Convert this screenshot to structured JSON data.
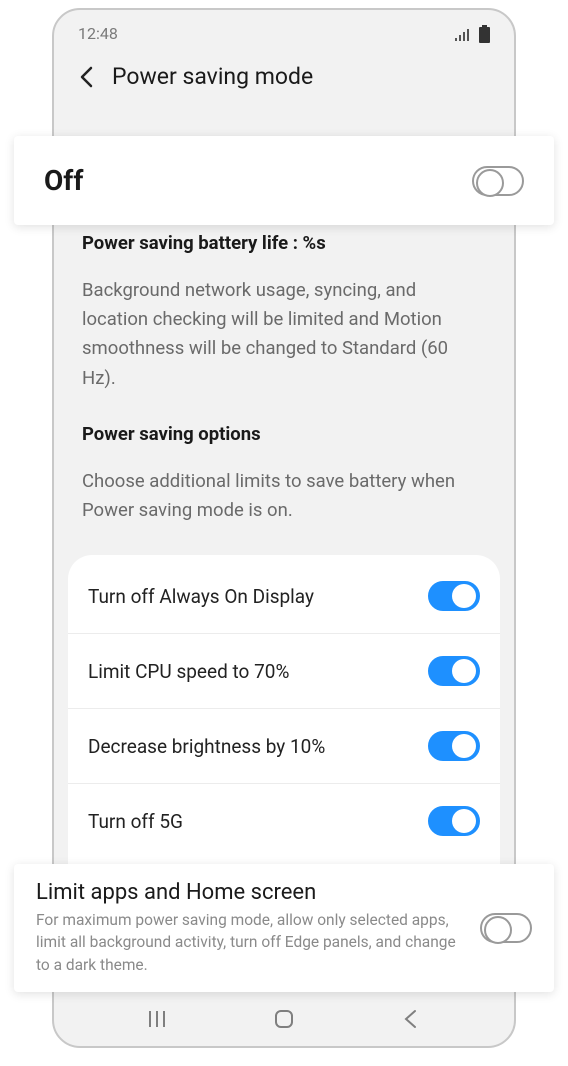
{
  "status": {
    "time": "12:48"
  },
  "header": {
    "title": "Power saving mode"
  },
  "main_toggle": {
    "label": "Off",
    "state": "off"
  },
  "battery_info": {
    "heading": "Power saving battery life : %s",
    "description": "Background network usage, syncing, and location checking will be limited and Motion smoothness will be changed to Standard (60 Hz)."
  },
  "options_section": {
    "heading": "Power saving options",
    "description": "Choose additional limits to save battery when Power saving mode is on."
  },
  "options": [
    {
      "label": "Turn off Always On Display",
      "state": "on"
    },
    {
      "label": "Limit CPU speed to 70%",
      "state": "on"
    },
    {
      "label": "Decrease brightness by 10%",
      "state": "on"
    },
    {
      "label": "Turn off 5G",
      "state": "on"
    }
  ],
  "limit_card": {
    "title": "Limit apps and Home screen",
    "description": "For maximum power saving mode, allow only selected apps, limit all background activity, turn off Edge panels, and change to a dark theme.",
    "state": "off"
  }
}
